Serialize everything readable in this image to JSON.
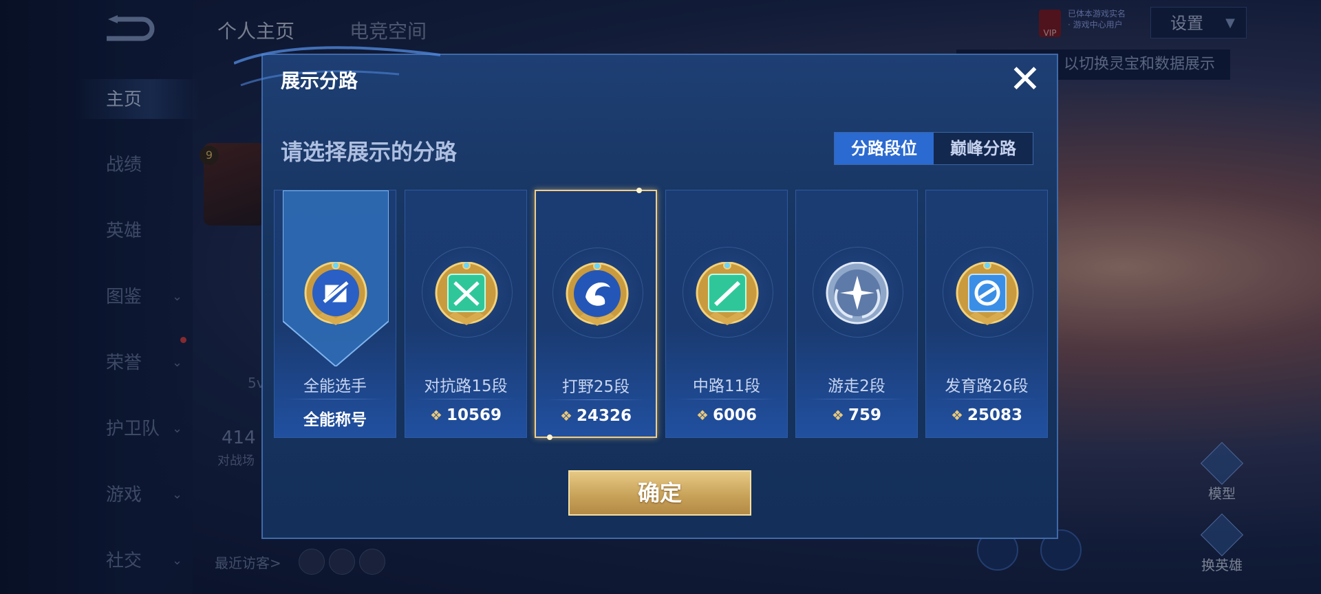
{
  "background": {
    "tabs": [
      "个人主页",
      "电竞空间"
    ],
    "nav": [
      {
        "label": "主页",
        "has_chevron": false
      },
      {
        "label": "战绩",
        "has_chevron": false
      },
      {
        "label": "英雄",
        "has_chevron": false
      },
      {
        "label": "图鉴",
        "has_chevron": true
      },
      {
        "label": "荣誉",
        "has_chevron": true
      },
      {
        "label": "护卫队",
        "has_chevron": true
      },
      {
        "label": "游戏",
        "has_chevron": true
      },
      {
        "label": "社交",
        "has_chevron": true
      }
    ],
    "vip_label": "VIP",
    "vip_text_1": "已体本游戏实名",
    "vip_text_2": "· 游戏中心用户",
    "settings_label": "设置",
    "hint_text": "以切换灵宝和数据展示",
    "level": "9",
    "mode_text": "5v",
    "count_text": "414",
    "count_sub": "对战场",
    "recent_label": "最近访客>",
    "right_actions": [
      "模型",
      "换英雄"
    ]
  },
  "dialog": {
    "title": "展示分路",
    "prompt": "请选择展示的分路",
    "toggle": {
      "active": "分路段位",
      "inactive": "巅峰分路"
    },
    "cards": [
      {
        "title": "全能选手",
        "value": "全能称号",
        "badge": "all-round-badge-icon",
        "selected": false,
        "show_points_icon": false
      },
      {
        "title": "对抗路15段",
        "value": "10569",
        "badge": "clash-lane-badge-icon",
        "selected": false,
        "show_points_icon": true
      },
      {
        "title": "打野25段",
        "value": "24326",
        "badge": "jungle-badge-icon",
        "selected": true,
        "show_points_icon": true
      },
      {
        "title": "中路11段",
        "value": "6006",
        "badge": "mid-lane-badge-icon",
        "selected": false,
        "show_points_icon": true
      },
      {
        "title": "游走2段",
        "value": "759",
        "badge": "roam-badge-icon",
        "selected": false,
        "show_points_icon": true
      },
      {
        "title": "发育路26段",
        "value": "25083",
        "badge": "farm-lane-badge-icon",
        "selected": false,
        "show_points_icon": true
      }
    ],
    "confirm_label": "确定",
    "close_icon": "close-icon"
  },
  "colors": {
    "dialog_bg": "#17345f",
    "accent_blue": "#2b6ad0",
    "selected_border": "#f0cf8a",
    "confirm_gold": "#c9a35a",
    "badge_green": "#2fc79a",
    "badge_blue": "#3a72d8"
  }
}
